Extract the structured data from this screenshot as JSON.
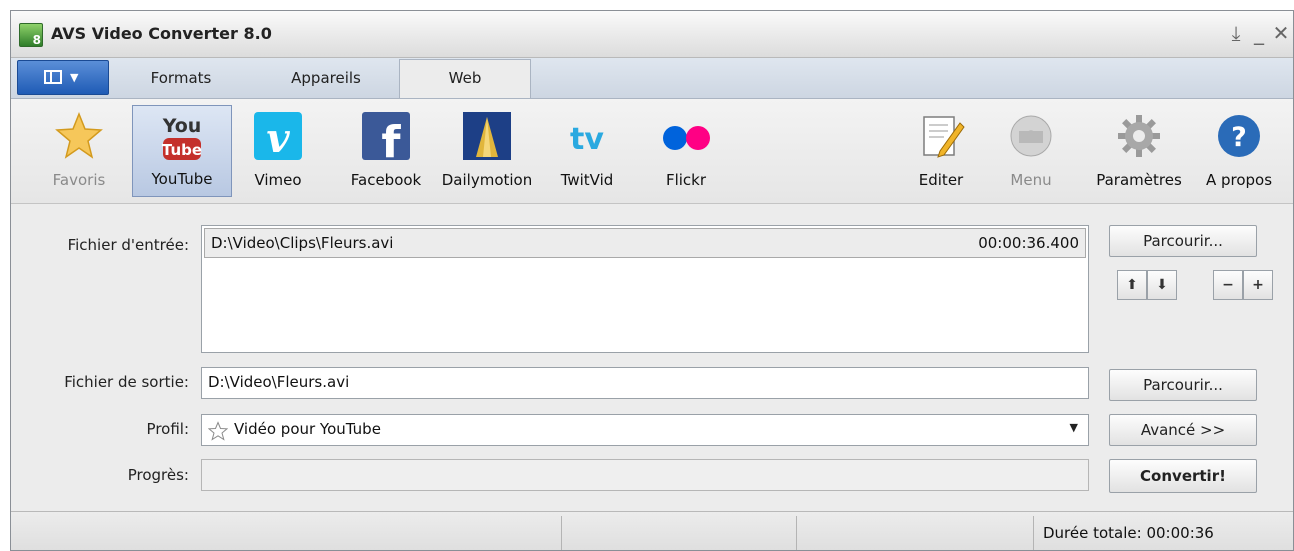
{
  "window": {
    "title": "AVS Video Converter 8.0"
  },
  "tabs": [
    {
      "label": "Formats"
    },
    {
      "label": "Appareils"
    },
    {
      "label": "Web"
    }
  ],
  "active_tab": "Web",
  "toolbar": {
    "left_items": [
      {
        "label": "Favoris",
        "icon": "star-icon"
      },
      {
        "label": "YouTube",
        "icon": "youtube-icon"
      },
      {
        "label": "Vimeo",
        "icon": "vimeo-icon"
      },
      {
        "label": "Facebook",
        "icon": "facebook-icon"
      },
      {
        "label": "Dailymotion",
        "icon": "dailymotion-icon"
      },
      {
        "label": "TwitVid",
        "icon": "twitvid-icon"
      },
      {
        "label": "Flickr",
        "icon": "flickr-icon"
      }
    ],
    "right_items": [
      {
        "label": "Editer",
        "icon": "edit-icon"
      },
      {
        "label": "Menu",
        "icon": "disc-menu-icon"
      },
      {
        "label": "Paramètres",
        "icon": "gear-icon"
      },
      {
        "label": "A propos",
        "icon": "help-icon"
      }
    ],
    "selected": "YouTube"
  },
  "form": {
    "input_label": "Fichier d'entrée:",
    "input_file": "D:\\Video\\Clips\\Fleurs.avi",
    "input_duration": "00:00:36.400",
    "browse_label": "Parcourir...",
    "output_label": "Fichier de sortie:",
    "output_file": "D:\\Video\\Fleurs.avi",
    "browse_output_label": "Parcourir...",
    "profile_label": "Profil:",
    "profile_value": "Vidéo pour YouTube",
    "advanced_label": "Avancé >>",
    "progress_label": "Progrès:",
    "convert_label": "Convertir!"
  },
  "status": {
    "total_duration": "Durée totale: 00:00:36"
  },
  "colors": {
    "youtube_red": "#c4302b",
    "vimeo": "#1ab7ea",
    "facebook": "#3b5998",
    "flickr_blue": "#0063dc",
    "flickr_pink": "#ff0084",
    "help_blue": "#2a6bb8"
  }
}
